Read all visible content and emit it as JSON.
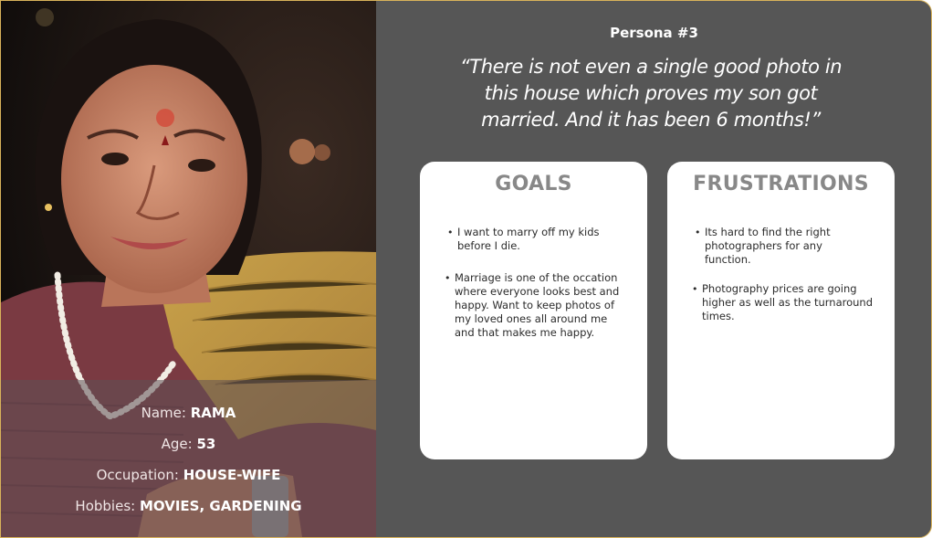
{
  "persona": {
    "label": "Persona #3",
    "quote": "“There is not even a single good photo in this house which proves my son got married. And it has been 6 months!”"
  },
  "profile": {
    "name_key": "Name:",
    "name_value": "RAMA",
    "age_key": "Age:",
    "age_value": "53",
    "occupation_key": "Occupation:",
    "occupation_value": "HOUSE-WIFE",
    "hobbies_key": "Hobbies:",
    "hobbies_value": "MOVIES, GARDENING"
  },
  "goals": {
    "title": "GOALS",
    "items": [
      "I want to marry off my kids before I die.",
      "Marriage is one of the occation where everyone looks best and happy. Want to keep photos of my loved ones all around me and that makes me happy."
    ]
  },
  "frustrations": {
    "title": "FRUSTRATIONS",
    "items": [
      "Its hard to find the right photographers for any function.",
      "Photography prices are going higher as well as the turnaround times."
    ]
  },
  "colors": {
    "panel_bg": "#565656",
    "card_bg": "#ffffff",
    "card_title": "#888888",
    "border_accent": "#d8b25a"
  }
}
